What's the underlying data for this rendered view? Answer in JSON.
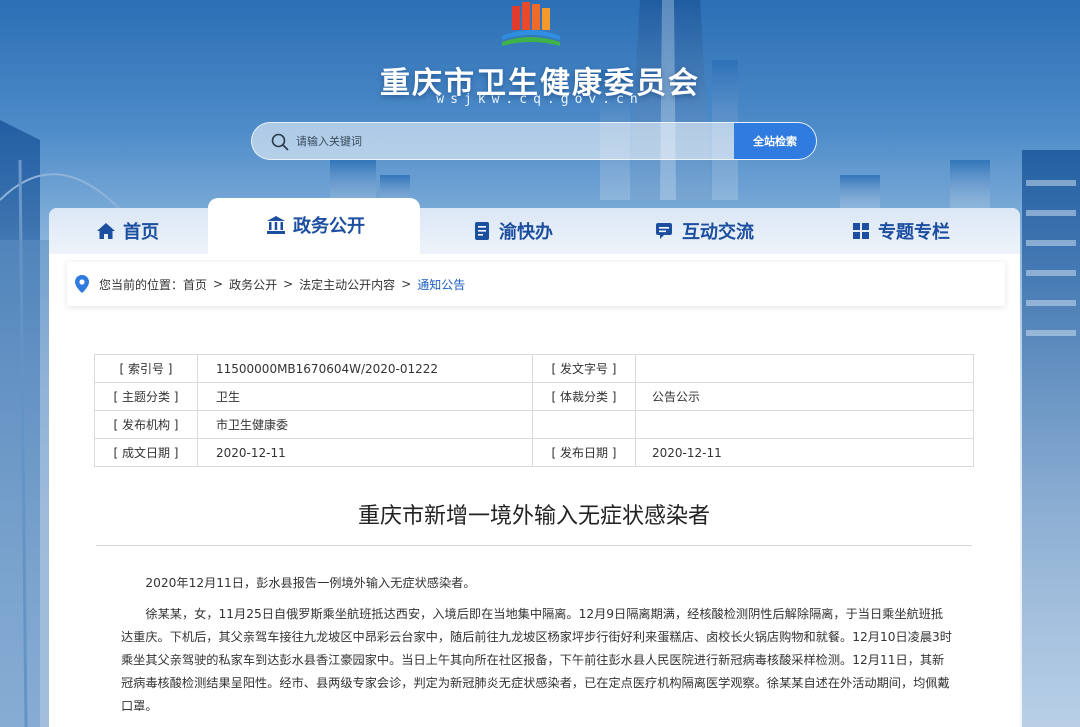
{
  "site": {
    "title": "重庆市卫生健康委员会",
    "domain": "wsjkw.cq.gov.cn"
  },
  "search": {
    "placeholder": "请输入关键词",
    "button_label": "全站检索"
  },
  "nav": {
    "items": [
      {
        "label": "首页",
        "icon": "home-icon"
      },
      {
        "label": "政务公开",
        "icon": "government-building-icon",
        "active": true
      },
      {
        "label": "渝快办",
        "icon": "document-list-icon"
      },
      {
        "label": "互动交流",
        "icon": "chat-bubble-icon"
      },
      {
        "label": "专题专栏",
        "icon": "grid-icon"
      }
    ]
  },
  "breadcrumb": {
    "prefix": "您当前的位置：",
    "items": [
      "首页",
      "政务公开",
      "法定主动公开内容",
      "通知公告"
    ],
    "separator": ">"
  },
  "meta": {
    "rows": [
      {
        "k1": "[ 索引号 ]",
        "v1": "11500000MB1670604W/2020-01222",
        "k2": "[ 发文字号 ]",
        "v2": ""
      },
      {
        "k1": "[ 主题分类 ]",
        "v1": "卫生",
        "k2": "[ 体裁分类 ]",
        "v2": "公告公示"
      },
      {
        "k1": "[ 发布机构 ]",
        "v1": "市卫生健康委",
        "k2": "",
        "v2": ""
      },
      {
        "k1": "[ 成文日期 ]",
        "v1": "2020-12-11",
        "k2": "[ 发布日期 ]",
        "v2": "2020-12-11"
      }
    ]
  },
  "article": {
    "title": "重庆市新增一境外输入无症状感染者",
    "paragraphs": [
      "2020年12月11日，彭水县报告一例境外输入无症状感染者。",
      "徐某某，女，11月25日自俄罗斯乘坐航班抵达西安，入境后即在当地集中隔离。12月9日隔离期满，经核酸检测阴性后解除隔离，于当日乘坐航班抵达重庆。下机后，其父亲驾车接往九龙坡区中昂彩云台家中，随后前往九龙坡区杨家坪步行街好利来蛋糕店、卤校长火锅店购物和就餐。12月10日凌晨3时乘坐其父亲驾驶的私家车到达彭水县香江豪园家中。当日上午其向所在社区报备，下午前往彭水县人民医院进行新冠病毒核酸采样检测。12月11日，其新冠病毒核酸检测结果呈阳性。经市、县两级专家会诊，判定为新冠肺炎无症状感染者，已在定点医疗机构隔离医学观察。徐某某自述在外活动期间，均佩戴口罩。"
    ]
  }
}
